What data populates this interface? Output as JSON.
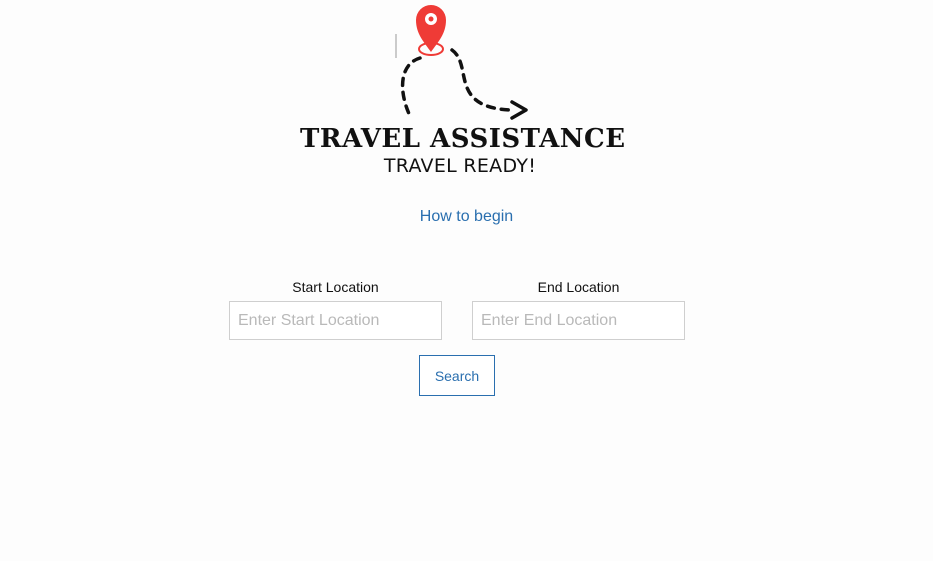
{
  "logo": {
    "title": "TRAVEL ASSISTANCE",
    "tagline": "TRAVEL READY!",
    "pin_color": "#ef3b36"
  },
  "how_to_begin": "How to begin",
  "start": {
    "label": "Start Location",
    "placeholder": "Enter Start Location"
  },
  "end": {
    "label": "End Location",
    "placeholder": "Enter End Location"
  },
  "search_label": "Search",
  "colors": {
    "accent": "#2a6faf",
    "background": "#fdfdfd"
  }
}
